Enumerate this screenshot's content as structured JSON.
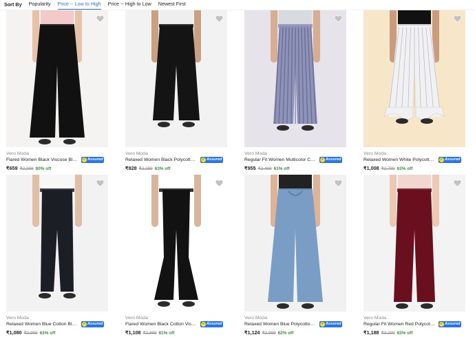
{
  "sort": {
    "label": "Sort By",
    "options": [
      "Popularity",
      "Price -- Low to High",
      "Price -- High to Low",
      "Newest First"
    ],
    "active": 1
  },
  "colors": {
    "accent": "#2874f0",
    "discount": "#388e3c",
    "muted": "#878787"
  },
  "assured_label": "Assured",
  "products": [
    {
      "brand": "Vero Moda",
      "title": "Flared Women Black Viscose Blend Trousers",
      "price": "₹659",
      "mrp": "₹2,299",
      "off": "80% off",
      "bg": "#f4f3f1",
      "pant": "#111111",
      "style": "wide",
      "skin": "#e8c2a8",
      "top": "#f3c9c9"
    },
    {
      "brand": "Vero Moda",
      "title": "Relaxed Women Black Polycotton Trousers",
      "price": "₹828",
      "mrp": "₹2,299",
      "off": "63% off",
      "bg": "#f2f2f2",
      "pant": "#141414",
      "style": "crop",
      "skin": "#caa083",
      "top": "#eeeeee"
    },
    {
      "brand": "Vero Moda",
      "title": "Regular Fit Women Multicolor Cotton Trousers",
      "price": "₹955",
      "mrp": "₹2,499",
      "off": "61% off",
      "bg": "#e6e4ea",
      "pant": "#8f93b8",
      "style": "stripe",
      "skin": "#d8ae92",
      "top": "#d9d9e0"
    },
    {
      "brand": "Vero Moda",
      "title": "Relaxed Women White Polycotton Trousers",
      "price": "₹1,008",
      "mrp": "₹2,799",
      "off": "63% off",
      "bg": "#f7e6c8",
      "pant": "#f1f1f3",
      "style": "ruffle",
      "skin": "#c99c7f",
      "top": "#111111"
    },
    {
      "brand": "Vero Moda",
      "title": "Relaxed Women Blue Cotton Blend Trousers",
      "price": "₹1,080",
      "mrp": "₹2,999",
      "off": "63% off",
      "bg": "#f2f2f2",
      "pant": "#1c1e26",
      "style": "slim",
      "skin": "#e0bfa6",
      "top": "#f7f7f7"
    },
    {
      "brand": "Vero Moda",
      "title": "Flared Women Black Cotton Viscose Trousers",
      "price": "₹1,108",
      "mrp": "₹2,899",
      "off": "61% off",
      "bg": "#ffffff",
      "pant": "#121212",
      "style": "flare",
      "skin": "#d9b59b",
      "top": "#ffffff"
    },
    {
      "brand": "Vero Moda",
      "title": "Relaxed Women Blue Polycotton Trousers",
      "price": "₹1,124",
      "mrp": "₹2,999",
      "off": "62% off",
      "bg": "#f1f1f1",
      "pant": "#7a9dc6",
      "style": "wide",
      "skin": "#ddb497",
      "top": "#222222"
    },
    {
      "brand": "Vero Moda",
      "title": "Regular Fit Women Red Polycotton Trousers",
      "price": "₹1,188",
      "mrp": "₹3,299",
      "off": "63% off",
      "bg": "#f3f3f3",
      "pant": "#6a0f1e",
      "style": "regular",
      "skin": "#ecc9b4",
      "top": "#f1d7cf"
    }
  ]
}
